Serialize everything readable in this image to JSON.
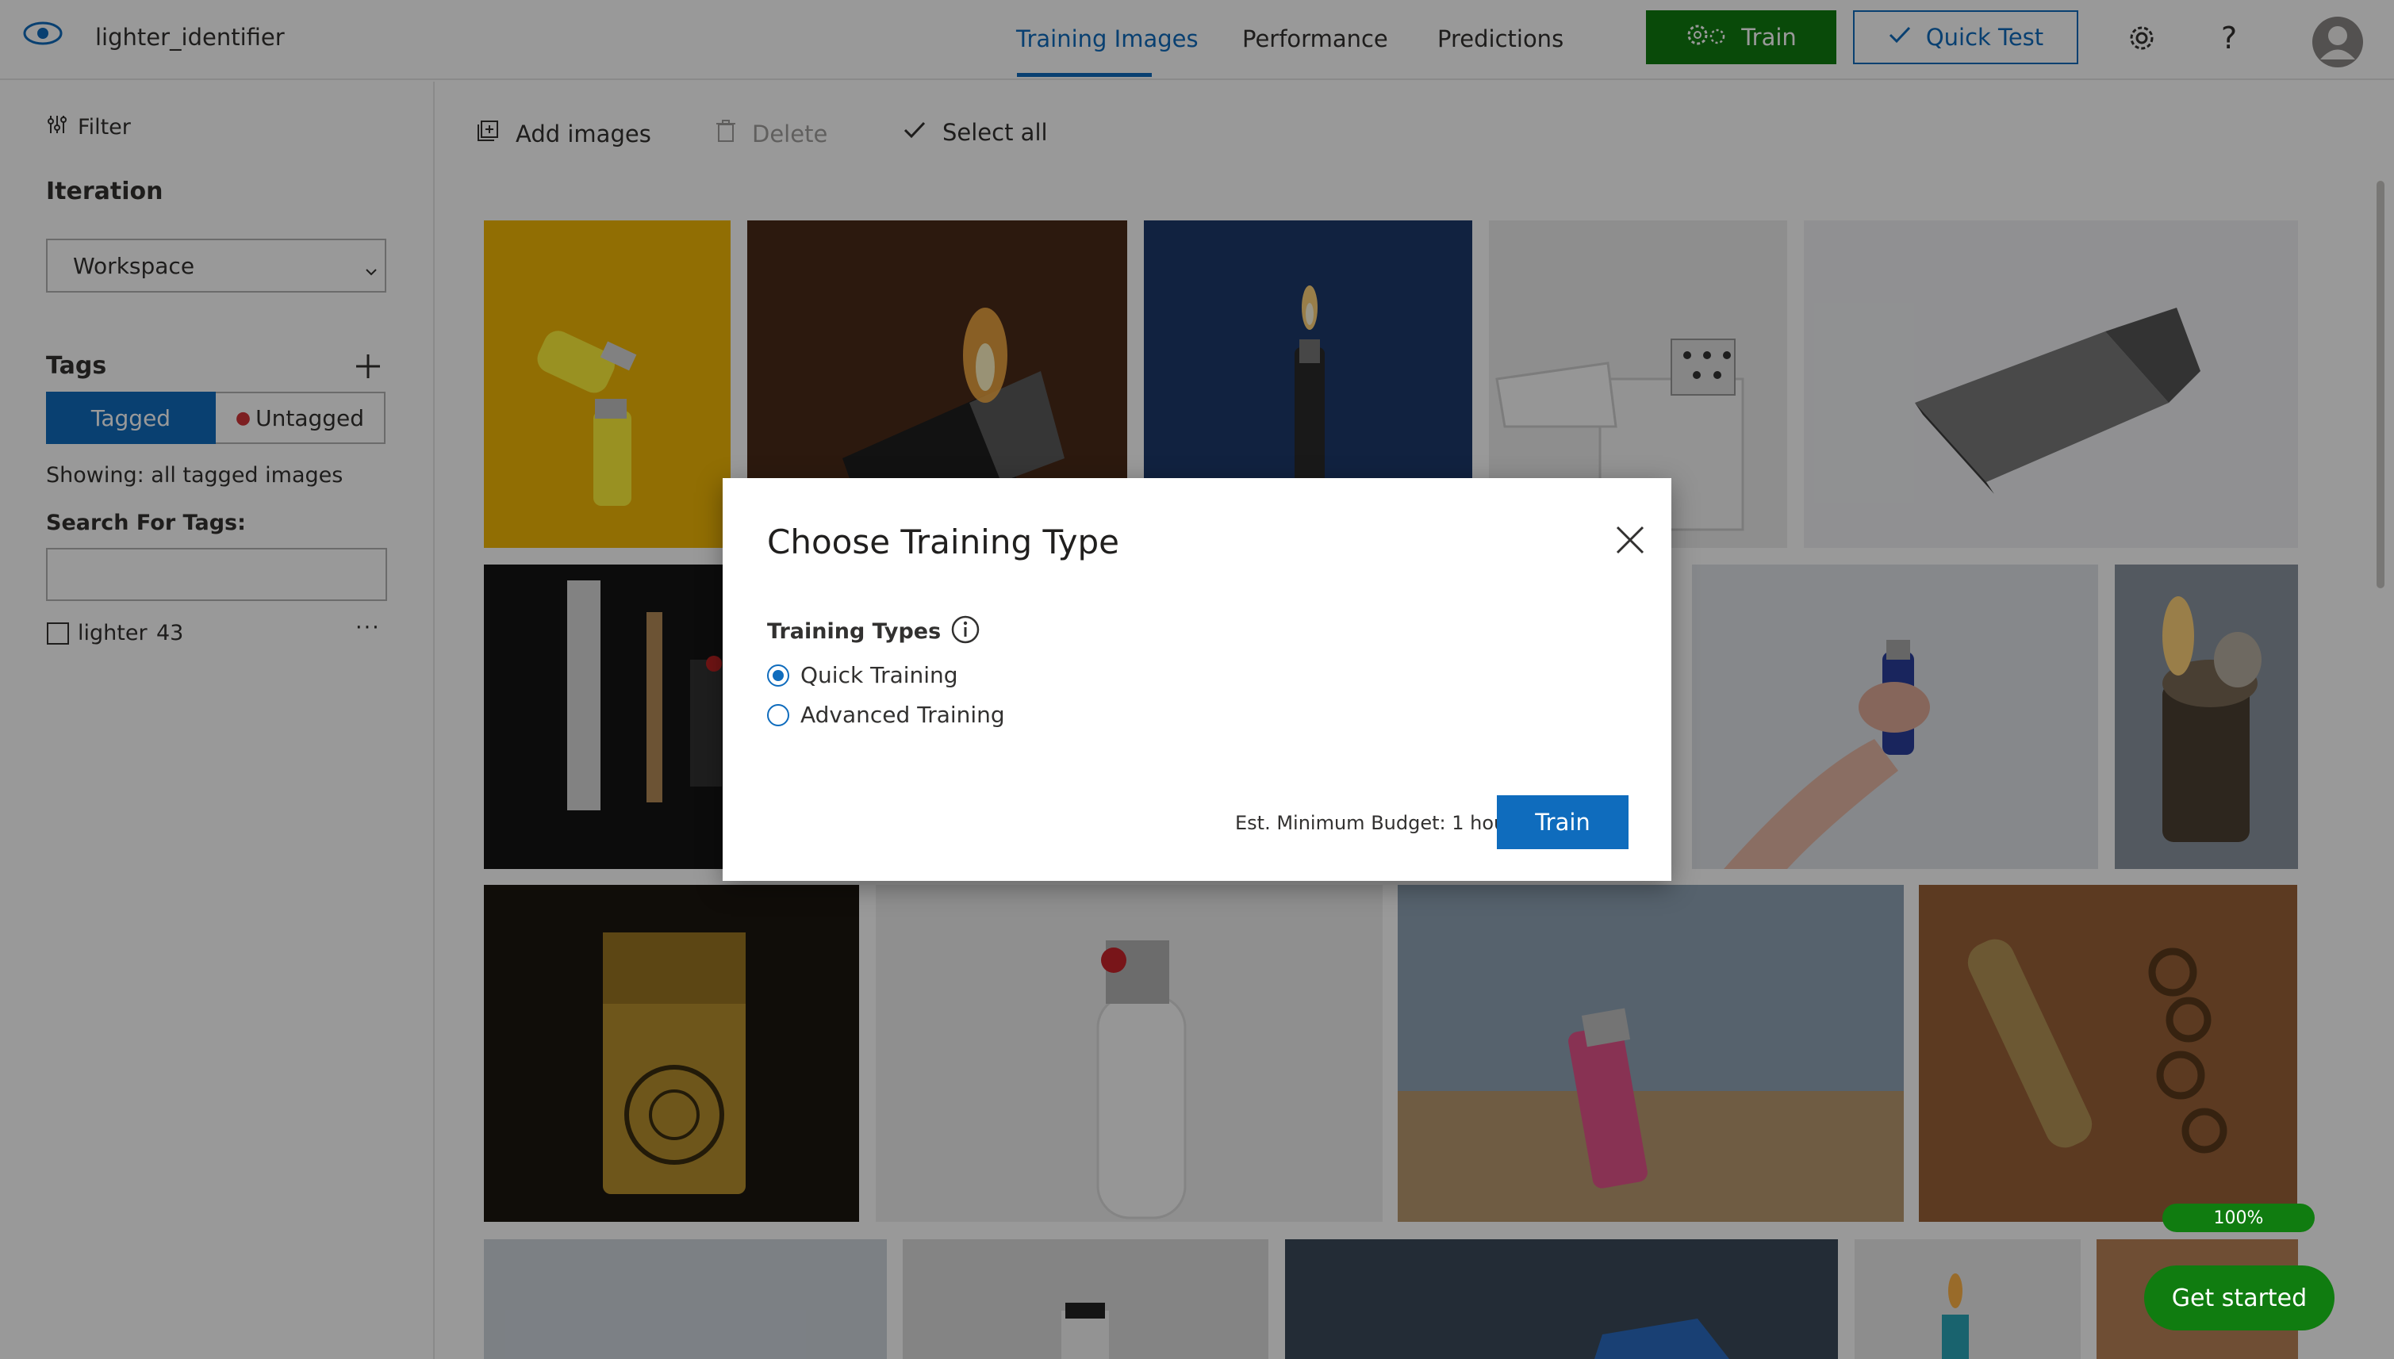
{
  "header": {
    "project_name": "lighter_identifier",
    "tabs": [
      {
        "label": "Training Images",
        "active": true
      },
      {
        "label": "Performance",
        "active": false
      },
      {
        "label": "Predictions",
        "active": false
      }
    ],
    "train_label": "Train",
    "quick_test_label": "Quick Test"
  },
  "sidebar": {
    "filter_label": "Filter",
    "iteration_heading": "Iteration",
    "iteration_value": "Workspace",
    "tags_heading": "Tags",
    "tagged_label": "Tagged",
    "untagged_label": "Untagged",
    "showing_text": "Showing: all tagged images",
    "search_label": "Search For Tags:",
    "search_value": "",
    "tag": {
      "name": "lighter",
      "count": "43",
      "more": "···"
    }
  },
  "toolbar": {
    "add_images": "Add images",
    "delete": "Delete",
    "select_all": "Select all"
  },
  "dialog": {
    "title": "Choose Training Type",
    "section_label": "Training Types",
    "options": [
      {
        "label": "Quick Training",
        "selected": true
      },
      {
        "label": "Advanced Training",
        "selected": false
      }
    ],
    "budget_text": "Est. Minimum Budget: 1 hour",
    "train_label": "Train"
  },
  "progress_text": "100%",
  "get_started_label": "Get started",
  "colors": {
    "accent": "#0f6cbd",
    "train_green": "#107c10"
  }
}
